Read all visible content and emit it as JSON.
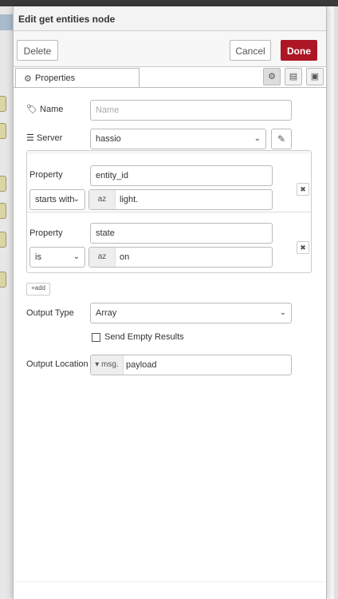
{
  "dialog": {
    "title": "Edit get entities node",
    "delete_label": "Delete",
    "cancel_label": "Cancel",
    "done_label": "Done",
    "tab_properties": "Properties"
  },
  "form": {
    "name_label": "Name",
    "name_placeholder": "Name",
    "server_label": "Server",
    "server_value": "hassio",
    "rules": [
      {
        "property_label": "Property",
        "property_value": "entity_id",
        "operator": "starts with",
        "type_tag": "az",
        "value": "light."
      },
      {
        "property_label": "Property",
        "property_value": "state",
        "operator": "is",
        "type_tag": "az",
        "value": "on"
      }
    ],
    "add_label": "add",
    "output_type_label": "Output Type",
    "output_type_value": "Array",
    "send_empty_label": "Send Empty Results",
    "send_empty_checked": false,
    "output_location_label": "Output Location",
    "output_location_prefix": "msg.",
    "output_location_value": "payload"
  },
  "icons": {
    "tag": "tag-icon",
    "server": "server-icon",
    "gear": "gear-icon",
    "pencil": "pencil-icon",
    "remove": "remove-icon",
    "plus": "plus-icon",
    "caret": "caret-down-icon"
  }
}
